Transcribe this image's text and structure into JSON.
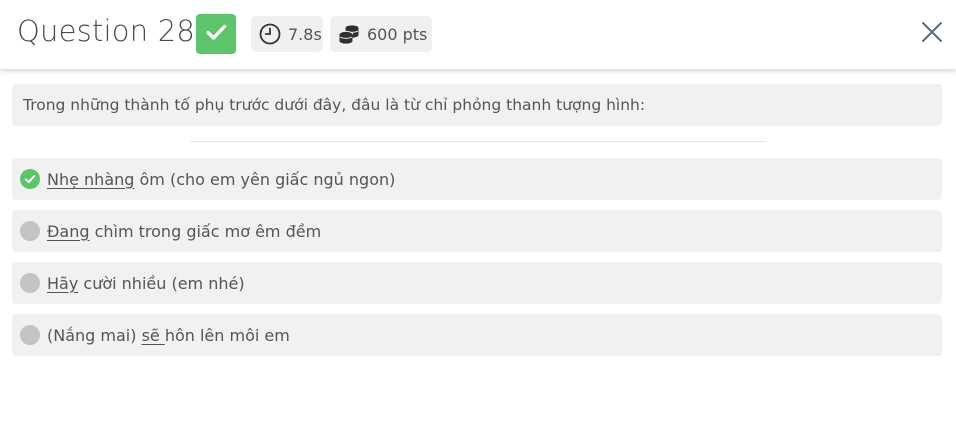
{
  "header": {
    "title": "Question 28",
    "status_icon": "check-icon",
    "timer": {
      "icon": "clock-icon",
      "value": "7.8s"
    },
    "points": {
      "icon": "coins-icon",
      "value": "600 pts"
    },
    "close_icon": "close-icon"
  },
  "question": {
    "text": "Trong những thành tố phụ trước dưới đây, đâu là từ chỉ phỏng thanh tượng hình:"
  },
  "options": [
    {
      "status": "correct",
      "before": "",
      "underlined": "Nhẹ nhàng",
      "after": " ôm (cho em yên giấc ngủ ngon)"
    },
    {
      "status": "neutral",
      "before": "",
      "underlined": "Đang",
      "after": " chìm trong giấc mơ êm đềm"
    },
    {
      "status": "neutral",
      "before": "",
      "underlined": "Hãy",
      "after": " cười nhiều (em nhé)"
    },
    {
      "status": "neutral",
      "before": "(Nắng mai) ",
      "underlined": "sẽ ",
      "after": "hôn lên môi em"
    }
  ],
  "colors": {
    "correct": "#5cc46b",
    "neutral": "#c4c4c4",
    "panel": "#f1f1f1"
  }
}
